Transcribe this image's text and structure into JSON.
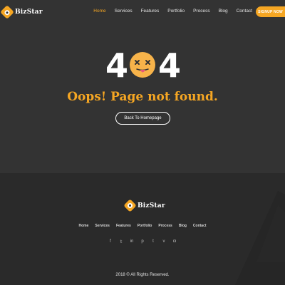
{
  "brand": {
    "name": "BizStar",
    "accent": "#f5a623"
  },
  "nav": {
    "links": [
      {
        "label": "Home",
        "active": true
      },
      {
        "label": "Services"
      },
      {
        "label": "Features"
      },
      {
        "label": "Portfolio"
      },
      {
        "label": "Process"
      },
      {
        "label": "Blog"
      },
      {
        "label": "Contact"
      }
    ],
    "signup": "SIGNUP NOW"
  },
  "error": {
    "digit_left": "4",
    "digit_right": "4",
    "message": "Oops! Page not found.",
    "back_button": "Back To Homepage"
  },
  "footer": {
    "links": [
      "Home",
      "Services",
      "Features",
      "Portfolio",
      "Process",
      "Blog",
      "Contact"
    ],
    "social": [
      {
        "name": "facebook-icon",
        "glyph": "f"
      },
      {
        "name": "twitter-icon",
        "glyph": "𝕥"
      },
      {
        "name": "linkedin-icon",
        "glyph": "in"
      },
      {
        "name": "pinterest-icon",
        "glyph": "p"
      },
      {
        "name": "tumblr-icon",
        "glyph": "t"
      },
      {
        "name": "vimeo-icon",
        "glyph": "v"
      },
      {
        "name": "instagram-icon",
        "glyph": "◘"
      }
    ],
    "copyright": "2018 © All Rights Reserved."
  }
}
